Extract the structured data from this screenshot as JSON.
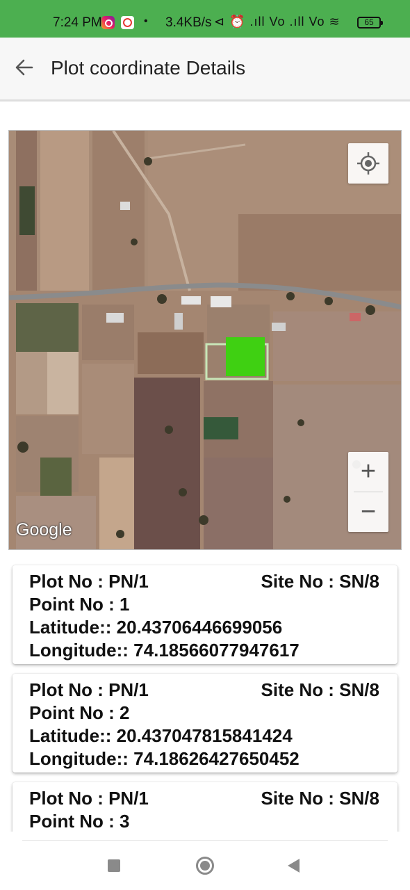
{
  "status_bar": {
    "time": "7:24 PM",
    "dot": "•",
    "net_speed": "3.4KB/s",
    "sys_icons": "⊲ ⏰ .ıll Vo .ıll Vo ≋",
    "battery": "65"
  },
  "app_bar": {
    "title": "Plot coordinate Details",
    "back_icon": "arrow-left-icon"
  },
  "map": {
    "attribution": "Google",
    "zoom_in_label": "+",
    "zoom_out_label": "−",
    "locate_icon": "my-location-icon",
    "plot_color": "#3fd012"
  },
  "points": [
    {
      "plot": "Plot No : PN/1",
      "site": "Site No : SN/8",
      "point": "Point No : 1",
      "latitude": "Latitude:: 20.43706446699056",
      "longitude": "Longitude:: 74.18566077947617"
    },
    {
      "plot": "Plot No : PN/1",
      "site": "Site No : SN/8",
      "point": "Point No : 2",
      "latitude": "Latitude:: 20.437047815841424",
      "longitude": "Longitude:: 74.18626427650452"
    },
    {
      "plot": "Plot No : PN/1",
      "site": "Site No : SN/8",
      "point": "Point No : 3",
      "latitude": "",
      "longitude": ""
    }
  ],
  "colors": {
    "status_bar": "#4caf50",
    "nav_icons": "#8a8a8a"
  }
}
